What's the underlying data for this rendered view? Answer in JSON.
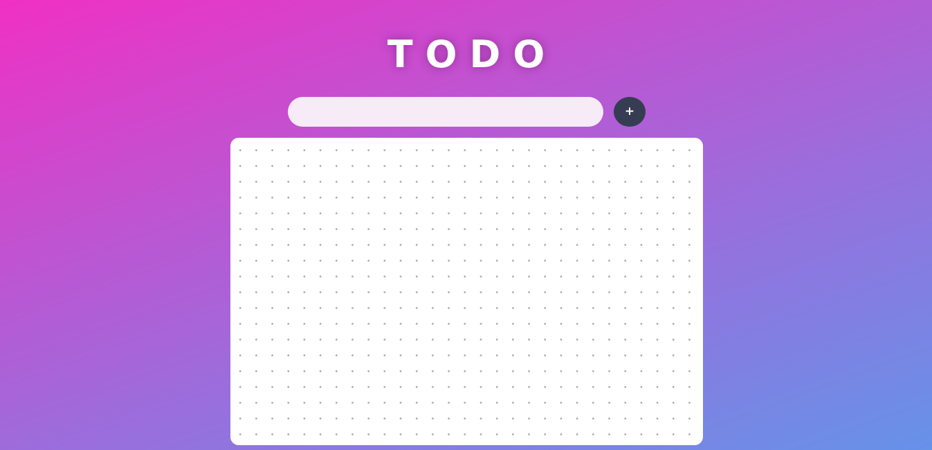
{
  "header": {
    "title": "TODO"
  },
  "form": {
    "input_value": "",
    "input_placeholder": "",
    "add_button_label": "+"
  },
  "list": {
    "items": []
  },
  "colors": {
    "gradient_start": "#f030c4",
    "gradient_end": "#6692e8",
    "input_background": "#f7ebf8",
    "add_button_background": "#363d52",
    "panel_background": "#ffffff",
    "dot_color": "#a9a9a9"
  }
}
